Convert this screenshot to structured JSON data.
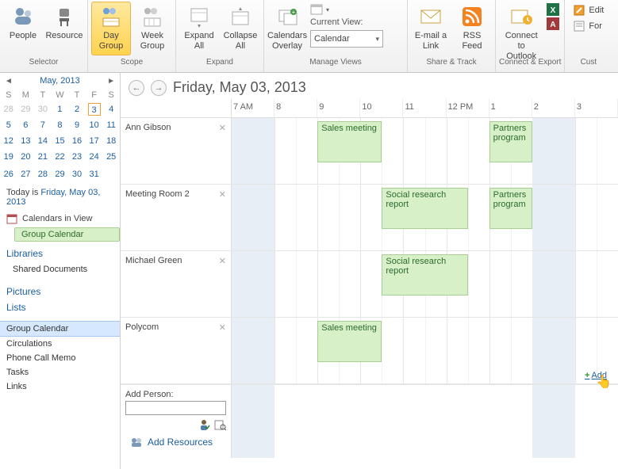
{
  "ribbon": {
    "groups": {
      "selector": {
        "caption": "Selector",
        "people": "People",
        "resource": "Resource"
      },
      "scope": {
        "caption": "Scope",
        "day_group": "Day Group",
        "week_group": "Week Group"
      },
      "expand": {
        "caption": "Expand",
        "expand_all": "Expand All",
        "collapse_all": "Collapse All"
      },
      "manage": {
        "caption": "Manage Views",
        "overlay": "Calendars Overlay",
        "current_view_label": "Current View:",
        "current_view": "Calendar"
      },
      "share": {
        "caption": "Share & Track",
        "email": "E-mail a Link",
        "rss": "RSS Feed"
      },
      "connect": {
        "caption": "Connect & Export",
        "outlook": "Connect to Outlook"
      },
      "cust": {
        "caption": "Cust",
        "edit": "Edit",
        "for": "For"
      }
    }
  },
  "sidebar": {
    "month_label": "May, 2013",
    "dow": [
      "S",
      "M",
      "T",
      "W",
      "T",
      "F",
      "S"
    ],
    "weeks": [
      [
        {
          "n": 28,
          "dim": true
        },
        {
          "n": 29,
          "dim": true
        },
        {
          "n": 30,
          "dim": true
        },
        {
          "n": 1
        },
        {
          "n": 2
        },
        {
          "n": 3,
          "sel": true
        },
        {
          "n": 4
        }
      ],
      [
        {
          "n": 5
        },
        {
          "n": 6
        },
        {
          "n": 7
        },
        {
          "n": 8
        },
        {
          "n": 9
        },
        {
          "n": 10
        },
        {
          "n": 11
        }
      ],
      [
        {
          "n": 12
        },
        {
          "n": 13
        },
        {
          "n": 14
        },
        {
          "n": 15
        },
        {
          "n": 16
        },
        {
          "n": 17
        },
        {
          "n": 18
        }
      ],
      [
        {
          "n": 19
        },
        {
          "n": 20
        },
        {
          "n": 21
        },
        {
          "n": 22
        },
        {
          "n": 23
        },
        {
          "n": 24
        },
        {
          "n": 25
        }
      ],
      [
        {
          "n": 26
        },
        {
          "n": 27
        },
        {
          "n": 28
        },
        {
          "n": 29
        },
        {
          "n": 30
        },
        {
          "n": 31
        },
        {
          "n": "",
          "dim": true
        }
      ]
    ],
    "today_prefix": "Today is ",
    "today_date": "Friday, May 03, 2013",
    "calendars_in_view": "Calendars in View",
    "group_calendar_chip": "Group Calendar",
    "libraries": "Libraries",
    "shared_docs": "Shared Documents",
    "pictures": "Pictures",
    "lists": "Lists",
    "list_items": [
      "Group Calendar",
      "Circulations",
      "Phone Call Memo",
      "Tasks",
      "Links"
    ],
    "selected_list": "Group Calendar"
  },
  "calendar": {
    "date_title": "Friday, May 03, 2013",
    "hours": [
      "7 AM",
      "8",
      "9",
      "10",
      "11",
      "12 PM",
      "1",
      "2",
      "3"
    ],
    "resources": [
      {
        "name": "Ann Gibson",
        "events": [
          {
            "title": "Sales meeting",
            "start": 2,
            "span": 1.5
          },
          {
            "title": "Partners program",
            "start": 6,
            "span": 1
          }
        ]
      },
      {
        "name": "Meeting Room 2",
        "events": [
          {
            "title": "Social research report",
            "start": 3.5,
            "span": 2
          },
          {
            "title": "Partners program",
            "start": 6,
            "span": 1
          }
        ]
      },
      {
        "name": "Michael Green",
        "events": [
          {
            "title": "Social research report",
            "start": 3.5,
            "span": 2
          }
        ]
      },
      {
        "name": "Polycom",
        "events": [
          {
            "title": "Sales meeting",
            "start": 2,
            "span": 1.5
          }
        ]
      }
    ],
    "add_person_label": "Add Person:",
    "add_resources": "Add Resources",
    "add_link": "Add"
  },
  "colors": {
    "accent": "#1a5ea0",
    "event_bg": "#d8f0c8",
    "event_border": "#a8cf92"
  }
}
